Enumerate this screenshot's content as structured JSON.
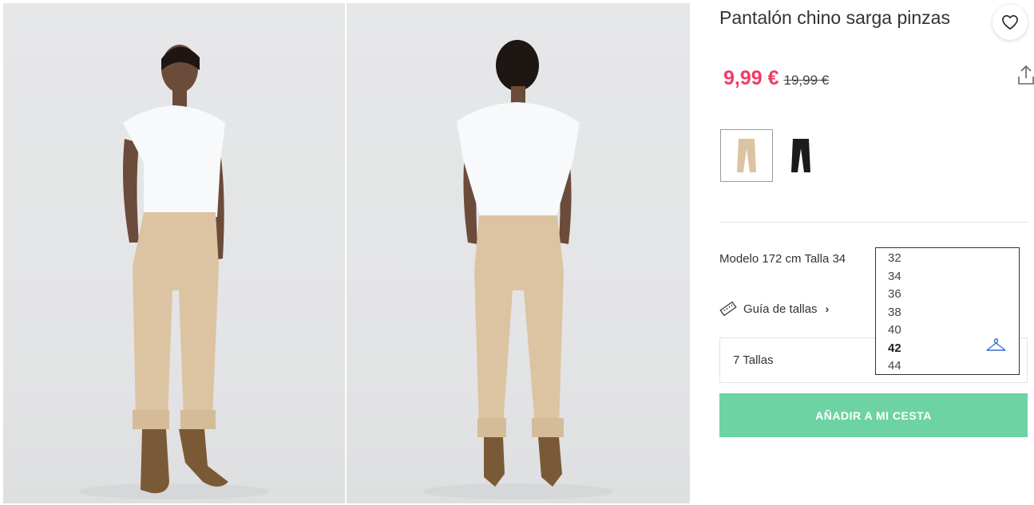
{
  "product": {
    "title": "Pantalón chino sarga pinzas",
    "price_current": "9,99 €",
    "price_original": "19,99 €",
    "price_color": "#f23b66"
  },
  "icons": {
    "favorite": "heart-icon",
    "share": "share-icon",
    "size_guide": "ruler-icon",
    "fit": "hanger-icon"
  },
  "colors": {
    "options": [
      "beige",
      "black"
    ],
    "selected": "beige"
  },
  "model_info": "Modelo 172 cm Talla 34",
  "size_guide_label": "Guía de tallas",
  "size_select": {
    "placeholder": "7 Tallas",
    "options": [
      "32",
      "34",
      "36",
      "38",
      "40",
      "42",
      "44"
    ],
    "highlighted": "42"
  },
  "add_to_cart": {
    "label": "AÑADIR A MI CESTA",
    "color": "#6ed3a2"
  }
}
